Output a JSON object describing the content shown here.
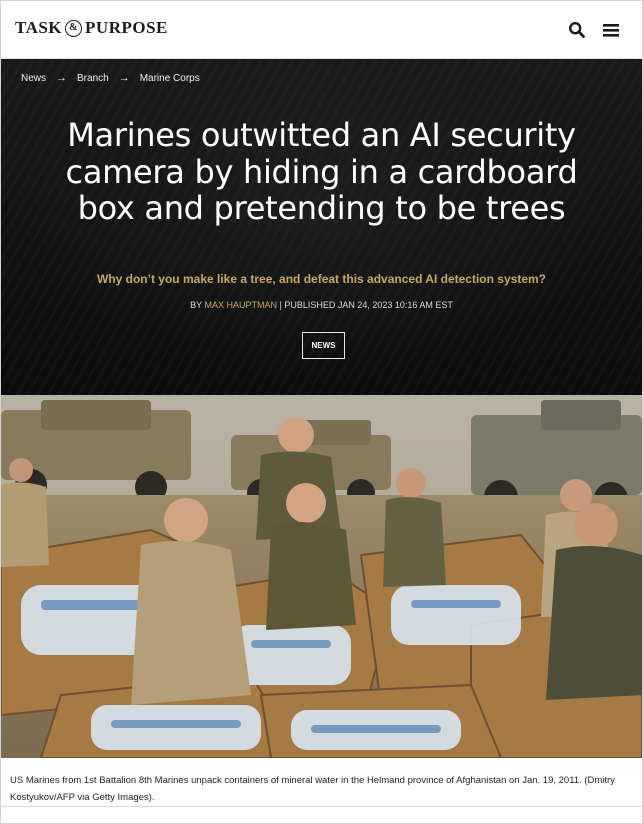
{
  "header": {
    "logo_left": "TASK",
    "logo_amp": "&",
    "logo_right": "PURPOSE",
    "icons": [
      "search-icon",
      "hamburger-menu-icon"
    ]
  },
  "breadcrumb": {
    "items": [
      "News",
      "Branch",
      "Marine Corps"
    ],
    "separator": "→"
  },
  "article": {
    "headline": "Marines outwitted an AI security camera by hiding in a cardboard box and pretending to be trees",
    "subhead": "Why don’t you make like a tree, and defeat this advanced AI detection system?",
    "by_label": "BY",
    "author": "MAX HAUPTMAN",
    "published": "| PUBLISHED JAN 24, 2023 10:16 AM EST",
    "tag": "NEWS"
  },
  "media": {
    "caption": "US Marines from 1st Battalion 8th Marines unpack containers of mineral water in the Helmand province of Afghanistan on Jan. 19, 2011. (Dmitry Kostyukov/AFP via Getty Images)."
  },
  "colors": {
    "hero_background": "#141414",
    "accent_gold": "#c9a96a",
    "text_dark": "#1c1c1c"
  }
}
